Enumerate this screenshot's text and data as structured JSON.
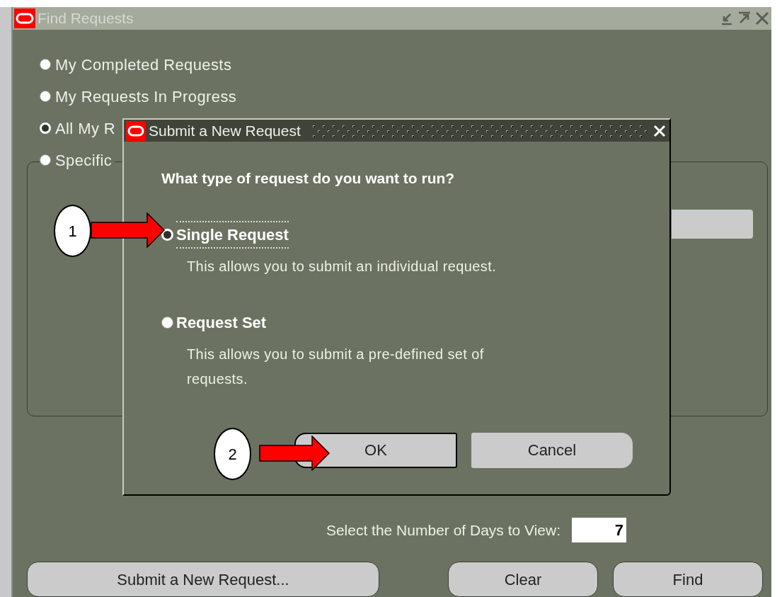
{
  "window": {
    "title": "Find Requests"
  },
  "options": [
    {
      "label": "My Completed Requests",
      "selected": false
    },
    {
      "label": "My Requests In Progress",
      "selected": false
    },
    {
      "label": "All My R",
      "selected": true
    },
    {
      "label": "Specific",
      "selected": false
    }
  ],
  "dialog": {
    "title": "Submit a New Request",
    "question": "What type of request do you want to run?",
    "choices": [
      {
        "label": "Single Request",
        "description": "This allows you to submit an individual request.",
        "selected": true,
        "focused": true
      },
      {
        "label": "Request Set",
        "description": "This allows you to submit a pre-defined set of requests.",
        "selected": false,
        "focused": false
      }
    ],
    "buttons": [
      "OK",
      "Cancel"
    ]
  },
  "days": {
    "label": "Select the Number of Days to View:",
    "value": "7"
  },
  "buttons": [
    "Submit a New Request...",
    "Clear",
    "Find"
  ],
  "callouts": [
    {
      "label": "1"
    },
    {
      "label": "2"
    }
  ]
}
